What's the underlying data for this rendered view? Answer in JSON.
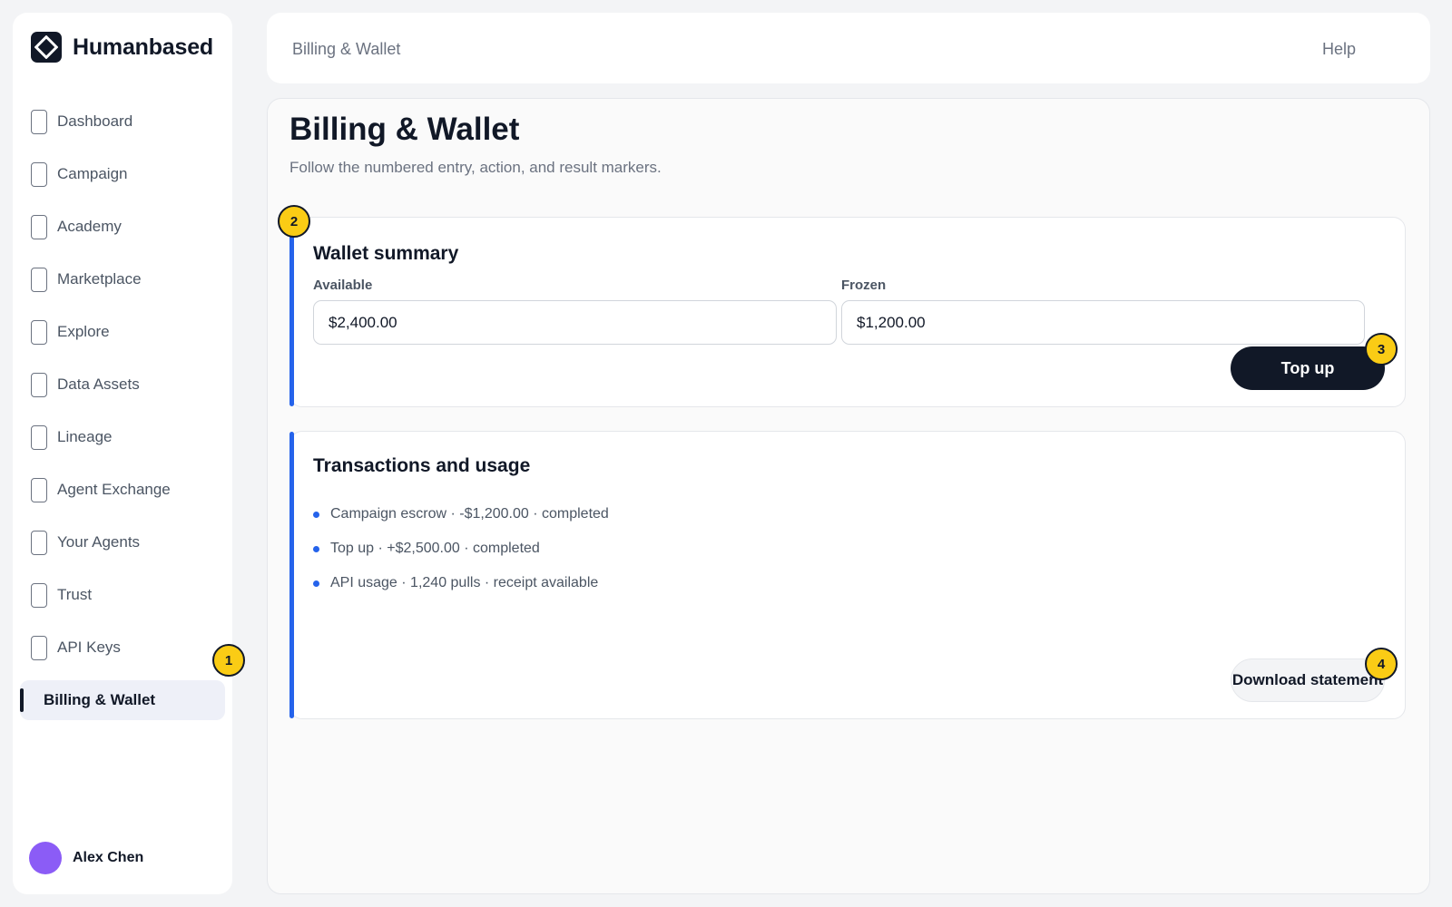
{
  "brand": {
    "name": "Humanbased",
    "logo_icon": "diamond-logo-icon"
  },
  "sidebar": {
    "items": [
      {
        "label": "Dashboard",
        "icon": "page-icon"
      },
      {
        "label": "Campaign",
        "icon": "page-icon"
      },
      {
        "label": "Academy",
        "icon": "page-icon"
      },
      {
        "label": "Marketplace",
        "icon": "page-icon"
      },
      {
        "label": "Explore",
        "icon": "page-icon"
      },
      {
        "label": "Data Assets",
        "icon": "page-icon"
      },
      {
        "label": "Lineage",
        "icon": "page-icon"
      },
      {
        "label": "Agent Exchange",
        "icon": "page-icon"
      },
      {
        "label": "Your Agents",
        "icon": "page-icon"
      },
      {
        "label": "Trust",
        "icon": "page-icon"
      },
      {
        "label": "API Keys",
        "icon": "page-icon"
      },
      {
        "label": "Billing & Wallet",
        "active": true
      }
    ]
  },
  "user": {
    "name": "Alex Chen",
    "avatar_color": "#8b5cf6"
  },
  "topbar": {
    "title": "Billing & Wallet",
    "help_label": "Help"
  },
  "page": {
    "title": "Billing & Wallet",
    "subtitle": "Follow the numbered entry, action, and result markers."
  },
  "wallet": {
    "title": "Wallet summary",
    "available_label": "Available",
    "available_value": "$2,400.00",
    "frozen_label": "Frozen",
    "frozen_value": "$1,200.00",
    "top_up_label": "Top up"
  },
  "transactions": {
    "title": "Transactions and usage",
    "items": [
      "Campaign escrow · -$1,200.00 · completed",
      "Top up · +$2,500.00 · completed",
      "API usage · 1,240 pulls · receipt available"
    ],
    "download_label": "Download statement"
  },
  "markers": [
    "1",
    "2",
    "3",
    "4"
  ],
  "colors": {
    "accent": "#2563eb",
    "marker": "#facc15",
    "primary_button": "#111827",
    "active_nav_bg": "#eef0f8"
  }
}
